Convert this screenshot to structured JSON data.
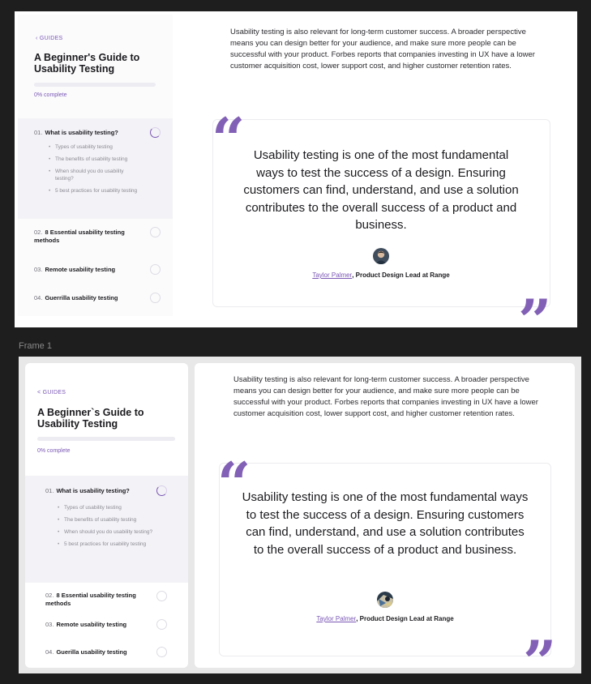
{
  "frame_label": "Frame 1",
  "colors": {
    "accent": "#7a57b5",
    "canvas": "#1e1e1e",
    "frame_bg": "#e8e8e8"
  },
  "original": {
    "sidebar": {
      "back_link": "‹ GUIDES",
      "title": "A Beginner's Guide to Usability Testing",
      "progress_label": "0% complete",
      "progress": 0,
      "items": [
        {
          "num": "01.",
          "label": "What is usability testing?",
          "status": "in-progress",
          "subitems": [
            "Types of usability testing",
            "The benefits of usability testing",
            "When should you do usability testing?",
            "5 best practices for usability testing"
          ]
        },
        {
          "num": "02.",
          "label": "8 Essential usability testing methods",
          "status": "not-started"
        },
        {
          "num": "03.",
          "label": "Remote usability testing",
          "status": "not-started"
        },
        {
          "num": "04.",
          "label": "Guerrilla usability testing",
          "status": "not-started"
        }
      ]
    },
    "main": {
      "intro": "Usability testing is also relevant for long-term customer success. A broader perspective means you can design better for your audience, and make sure more people can be successful with your product. Forbes reports that companies investing in UX have a lower customer acquisition cost, lower support cost, and higher customer retention rates.",
      "quote": "Usability testing is one of the most fundamental ways to test the success of a design. Ensuring customers can find, understand, and use a solution contributes to the overall success of a product and business.",
      "author": "Taylor Palmer",
      "role": ", Product Design Lead at Range",
      "open_mark": "“",
      "close_mark": "”"
    }
  },
  "frame1": {
    "sidebar": {
      "back_link": "< GUIDES",
      "title": "A Beginner`s Guide to Usability Testing",
      "progress_label": "0% complete",
      "progress": 0,
      "items": [
        {
          "num": "01.",
          "label": "What is usability testing?",
          "status": "in-progress",
          "subitems": [
            "Types of usability testing",
            "The benefits of usability testing",
            "When should you do usability testing?",
            "5 best practices for usability testing"
          ]
        },
        {
          "num": "02.",
          "label": "8 Essential usability testing methods",
          "status": "not-started"
        },
        {
          "num": "03.",
          "label": "Remote usability testing",
          "status": "not-started"
        },
        {
          "num": "04.",
          "label": "Guerilla usability testing",
          "status": "not-started"
        }
      ]
    },
    "main": {
      "intro": "Usability testing is also relevant for long-term customer success. A broader perspective means you can design better for your audience, and make sure more people can be successful with your product. Forbes reports that companies investing in UX have a lower customer acquisition cost, lower support cost, and higher customer retention rates.",
      "quote": "Usability testing is one of the most fundamental ways to test the success of a design. Ensuring customers can find, understand, and use a solution contributes to the overall success of a product and business.",
      "author": "Taylor Palmer",
      "role": ", Product Design Lead at Range",
      "open_mark": "“",
      "close_mark": "”"
    }
  }
}
